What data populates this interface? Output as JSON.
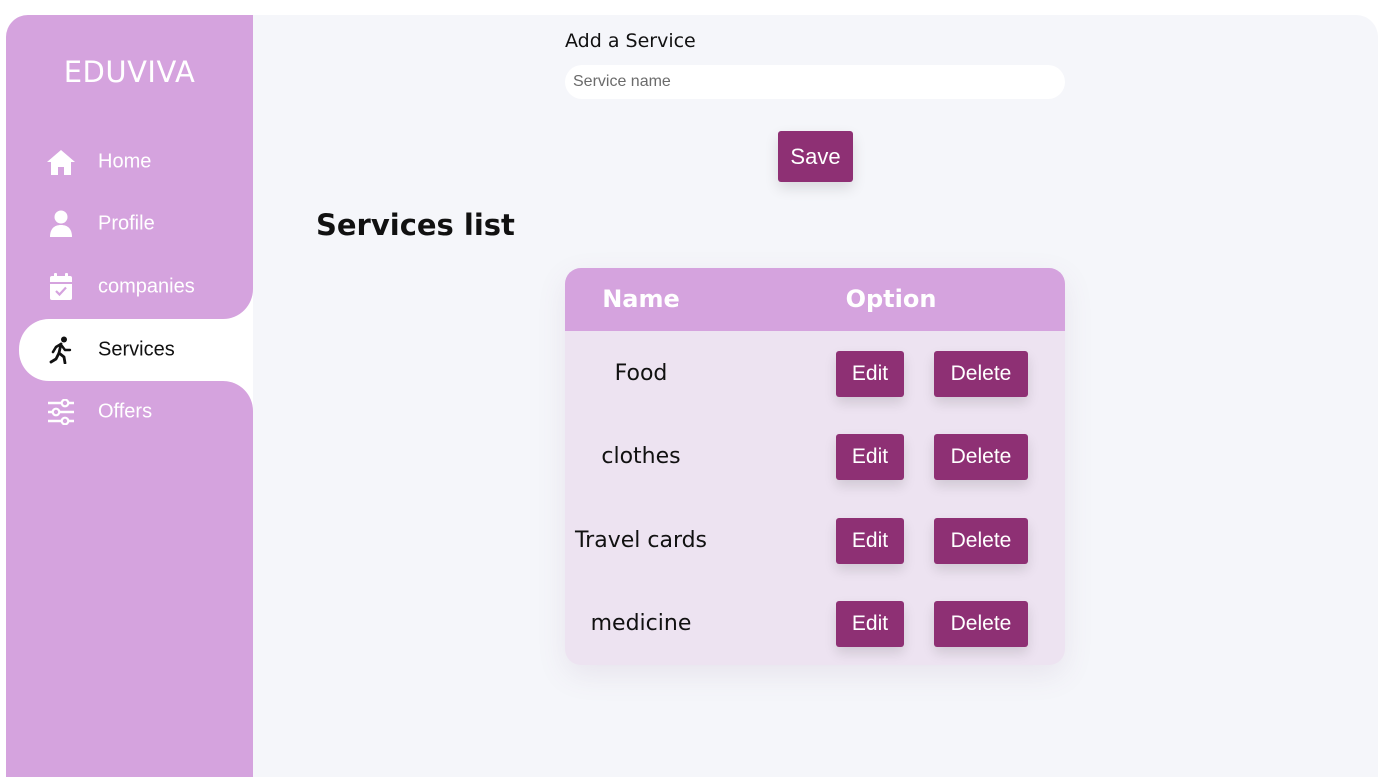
{
  "brand": "EDUVIVA",
  "nav": {
    "items": [
      {
        "label": "Home",
        "icon": "home-icon"
      },
      {
        "label": "Profile",
        "icon": "person-icon"
      },
      {
        "label": "companies",
        "icon": "calendar-check-icon"
      },
      {
        "label": "Services",
        "icon": "running-person-icon",
        "active": true
      },
      {
        "label": "Offers",
        "icon": "sliders-icon"
      }
    ]
  },
  "form": {
    "label": "Add a Service",
    "placeholder": "Service name",
    "value": "",
    "save_label": "Save"
  },
  "services": {
    "title": "Services list",
    "columns": [
      "Name",
      "Option"
    ],
    "rows": [
      {
        "name": "Food"
      },
      {
        "name": "clothes"
      },
      {
        "name": "Travel cards"
      },
      {
        "name": "medicine"
      }
    ],
    "edit_label": "Edit",
    "delete_label": "Delete"
  },
  "colors": {
    "sidebar": "#d5a3de",
    "accent": "#8e3074",
    "background": "#f5f6fa",
    "table_body": "#ede3f1"
  }
}
